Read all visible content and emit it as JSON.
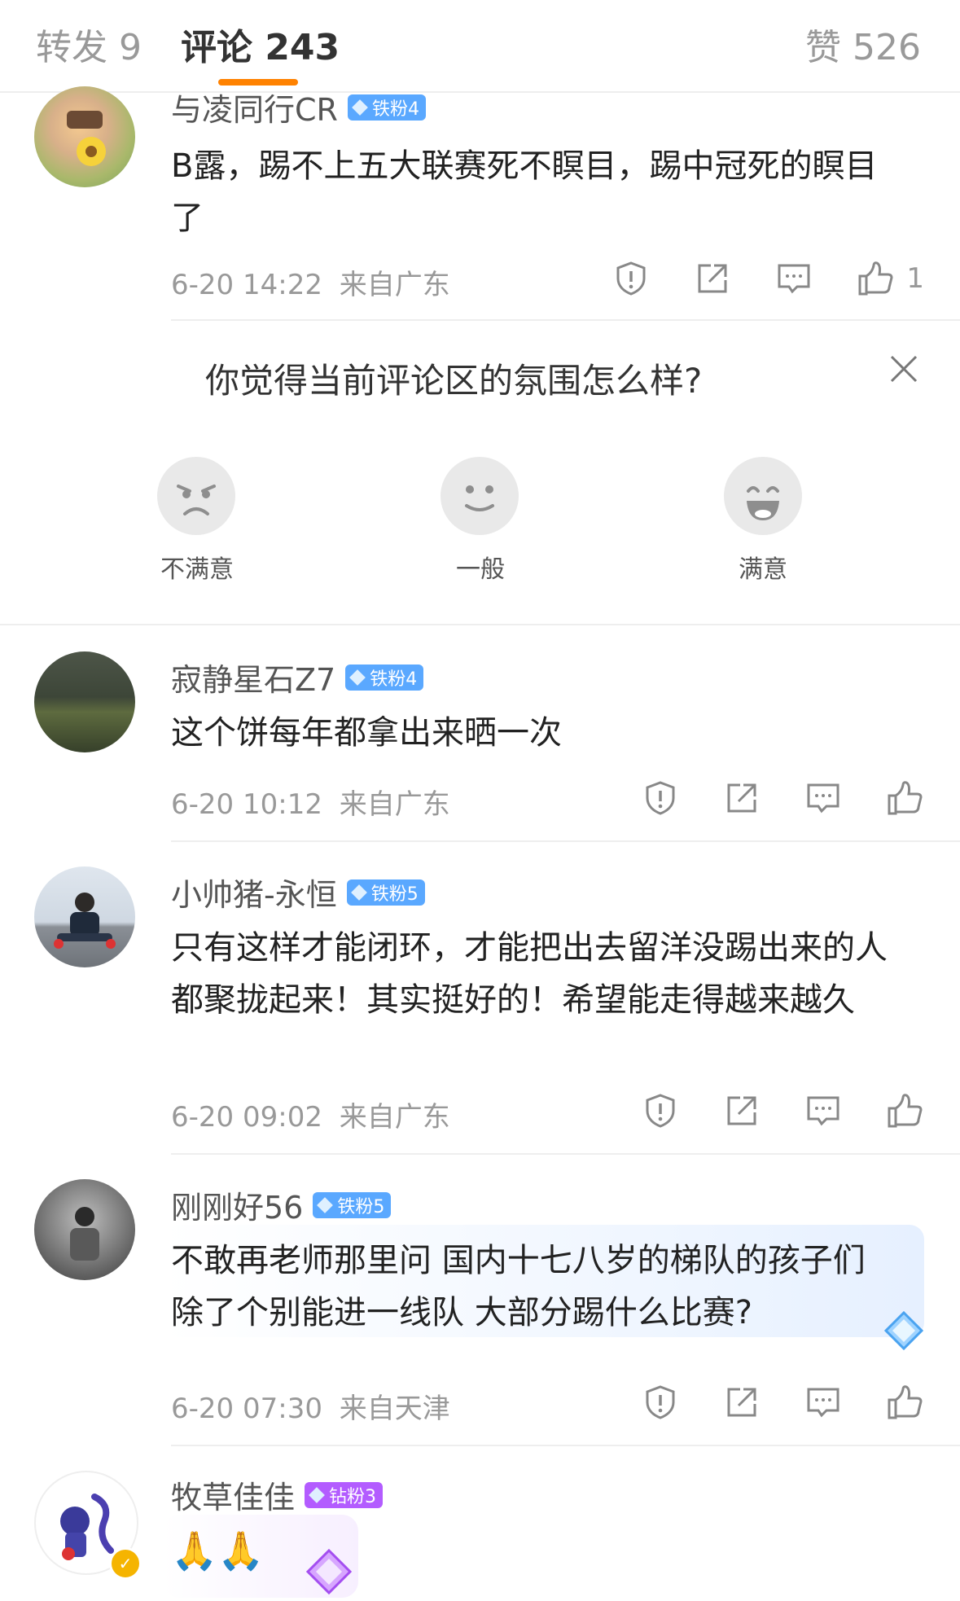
{
  "tabs": {
    "repost": "转发 9",
    "comment": "评论 243",
    "like": "赞 526"
  },
  "survey": {
    "title": "你觉得当前评论区的氛围怎么样?",
    "options": [
      "不满意",
      "一般",
      "满意"
    ]
  },
  "comments": [
    {
      "user": "与凌同行CR",
      "badge": "铁粉4",
      "text": "B露，踢不上五大联赛死不瞑目，踢中冠死的瞑目了",
      "time": "6-20 14:22",
      "location": "来自广东",
      "likes": "1"
    },
    {
      "user": "寂静星石Z7",
      "badge": "铁粉4",
      "text": "这个饼每年都拿出来晒一次",
      "time": "6-20 10:12",
      "location": "来自广东",
      "likes": ""
    },
    {
      "user": "小帅猪-永恒",
      "badge": "铁粉5",
      "text": "只有这样才能闭环，才能把出去留洋没踢出来的人都聚拢起来！其实挺好的！希望能走得越来越久",
      "time": "6-20 09:02",
      "location": "来自广东",
      "likes": ""
    },
    {
      "user": "刚刚好56",
      "badge": "铁粉5",
      "text": "不敢再老师那里问 国内十七八岁的梯队的孩子们 除了个别能进一线队 大部分踢什么比赛?",
      "time": "6-20 07:30",
      "location": "来自天津",
      "likes": ""
    },
    {
      "user": "牧草佳佳",
      "badge": "钻粉3",
      "text": "🙏🙏"
    }
  ],
  "colors": {
    "accent": "#ff8200",
    "fan_badge": "#5aa8ff",
    "diamond_badge": "#b35cff"
  }
}
